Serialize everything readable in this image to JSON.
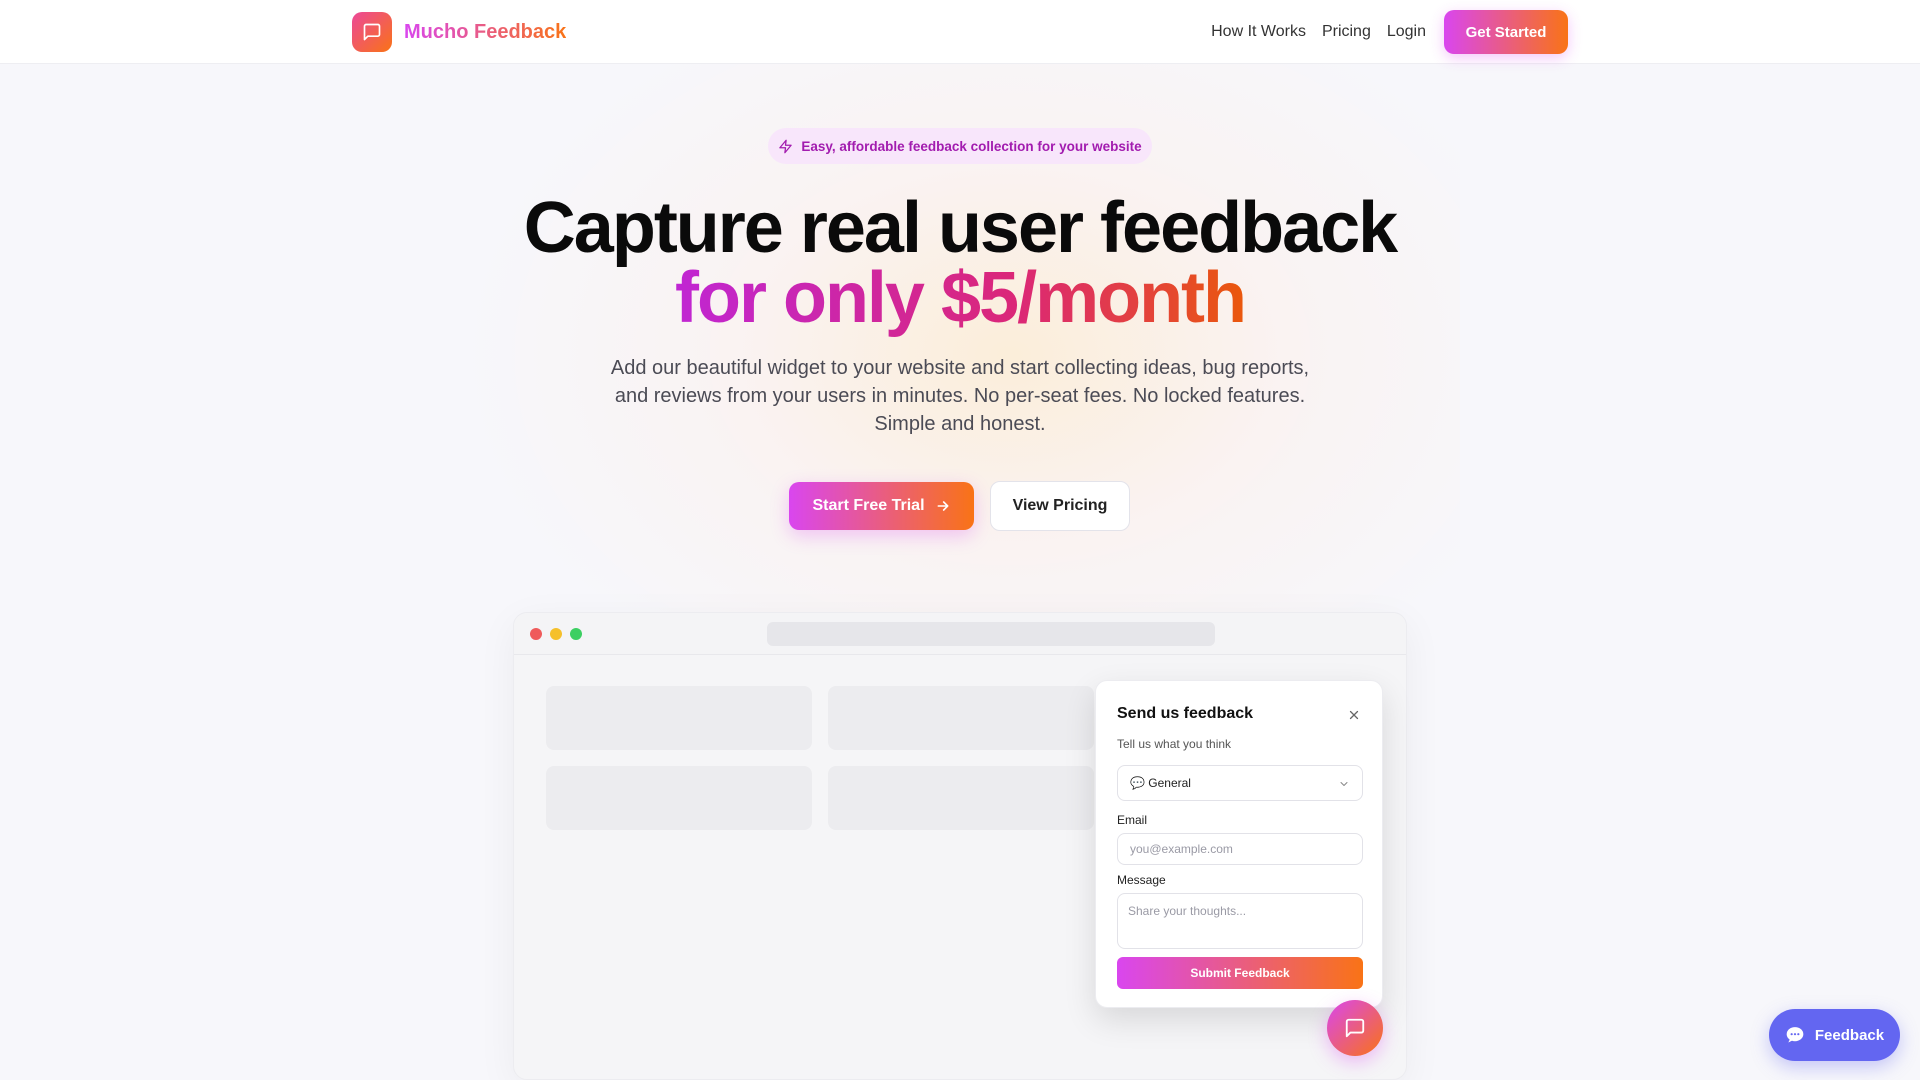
{
  "brand": {
    "name": "Mucho Feedback",
    "logo_icon": "message-square-icon",
    "gradient_from": "#d946ef",
    "gradient_to": "#f97316"
  },
  "nav": {
    "links": [
      "How It Works",
      "Pricing",
      "Login"
    ],
    "cta_label": "Get Started"
  },
  "hero": {
    "badge_icon": "lightning-icon",
    "badge_text": "Easy, affordable feedback collection for your website",
    "headline_line1": "Capture real user feedback",
    "headline_line2": "for only $5/month",
    "subtext": "Add our beautiful widget to your website and start collecting ideas, bug reports, and reviews from your users in minutes. No per-seat fees. No locked features. Simple and honest.",
    "primary_cta": "Start Free Trial",
    "secondary_cta": "View Pricing"
  },
  "browser_mock": {
    "dot_colors": [
      "#ef5b5b",
      "#f5c02b",
      "#3ccf62"
    ]
  },
  "widget": {
    "title": "Send us feedback",
    "subtitle": "Tell us what you think",
    "select_value": "💬 General",
    "email_label": "Email",
    "email_placeholder": "you@example.com",
    "message_label": "Message",
    "message_placeholder": "Share your thoughts...",
    "submit_label": "Submit Feedback"
  },
  "floating_button": {
    "label": "Feedback",
    "icon": "chat-bubble-icon",
    "color": "#6366f1"
  }
}
